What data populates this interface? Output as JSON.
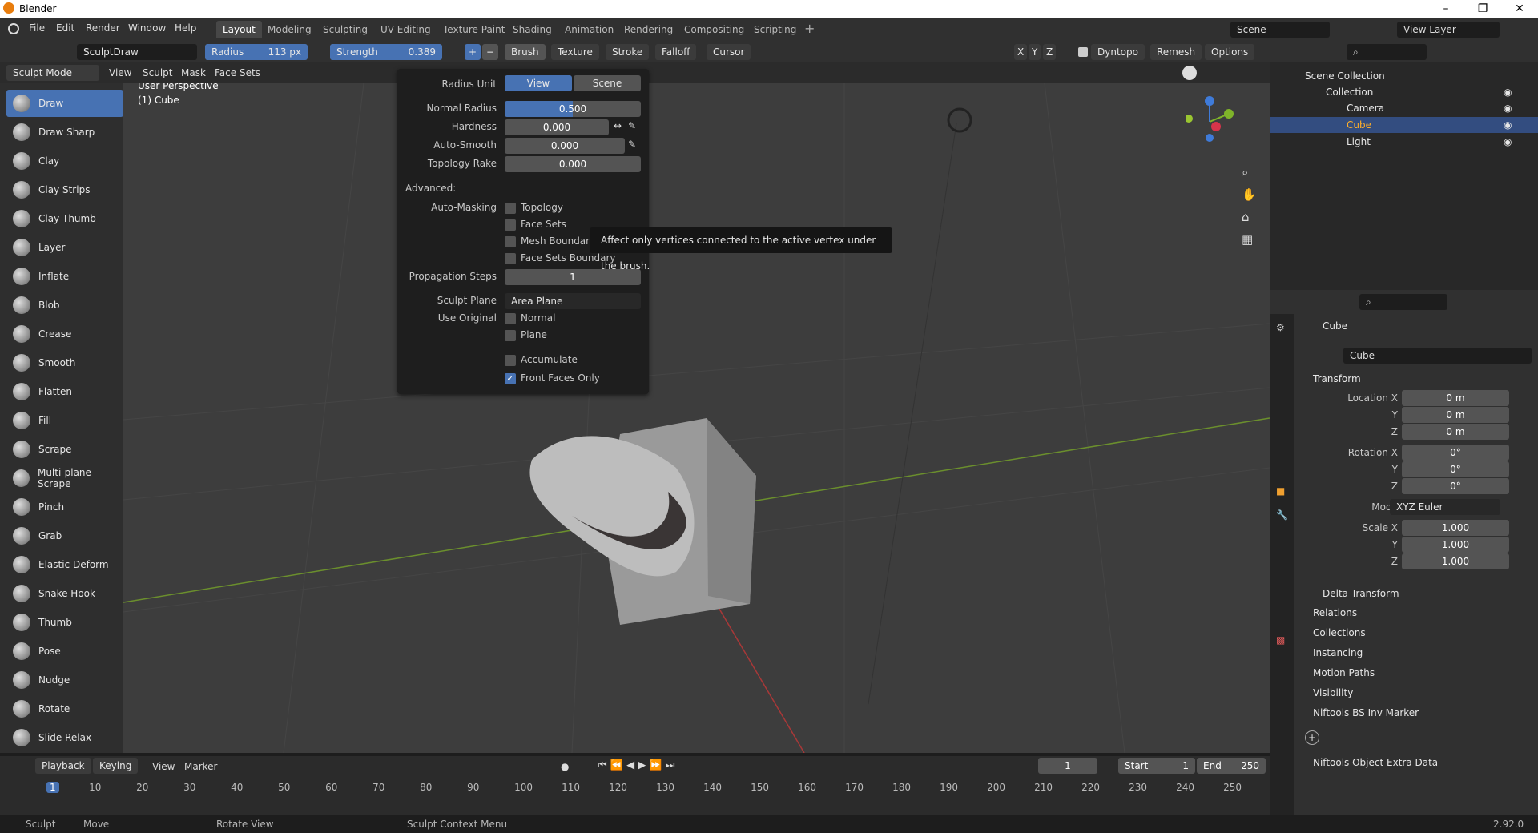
{
  "window": {
    "title": "Blender"
  },
  "menu": [
    "File",
    "Edit",
    "Render",
    "Window",
    "Help"
  ],
  "workspaces": [
    "Layout",
    "Modeling",
    "Sculpting",
    "UV Editing",
    "Texture Paint",
    "Shading",
    "Animation",
    "Rendering",
    "Compositing",
    "Scripting"
  ],
  "scene": "Scene",
  "view_layer": "View Layer",
  "header": {
    "brush_name": "SculptDraw",
    "radius_label": "Radius",
    "radius_value": "113 px",
    "strength_label": "Strength",
    "strength_value": "0.389",
    "menus": [
      "Brush",
      "Texture",
      "Stroke",
      "Falloff",
      "Cursor"
    ],
    "axes": [
      "X",
      "Y",
      "Z"
    ],
    "dyntopo": "Dyntopo",
    "remesh": "Remesh",
    "options": "Options"
  },
  "header2": {
    "mode": "Sculpt Mode",
    "menus": [
      "View",
      "Sculpt",
      "Mask",
      "Face Sets"
    ]
  },
  "viewport": {
    "perspective": "User Perspective",
    "object": "(1) Cube"
  },
  "tools": [
    "Draw",
    "Draw Sharp",
    "Clay",
    "Clay Strips",
    "Clay Thumb",
    "Layer",
    "Inflate",
    "Blob",
    "Crease",
    "Smooth",
    "Flatten",
    "Fill",
    "Scrape",
    "Multi-plane Scrape",
    "Pinch",
    "Grab",
    "Elastic Deform",
    "Snake Hook",
    "Thumb",
    "Pose",
    "Nudge",
    "Rotate",
    "Slide Relax"
  ],
  "popover": {
    "radius_unit_label": "Radius Unit",
    "view_btn": "View",
    "scene_btn": "Scene",
    "normal_radius_label": "Normal Radius",
    "normal_radius": "0.500",
    "normal_radius_fraction": 0.5,
    "hardness_label": "Hardness",
    "hardness": "0.000",
    "auto_smooth_label": "Auto-Smooth",
    "auto_smooth": "0.000",
    "topology_rake_label": "Topology Rake",
    "topology_rake": "0.000",
    "advanced_label": "Advanced:",
    "auto_masking_label": "Auto-Masking",
    "masking": [
      "Topology",
      "Face Sets",
      "Mesh Boundary",
      "Face Sets Boundary"
    ],
    "propagation_label": "Propagation Steps",
    "propagation": "1",
    "sculpt_plane_label": "Sculpt Plane",
    "sculpt_plane": "Area Plane",
    "use_original_label": "Use Original",
    "normal": "Normal",
    "plane": "Plane",
    "accumulate": "Accumulate",
    "front_faces_only": "Front Faces Only",
    "front_faces_checked": true
  },
  "tooltip": "Affect only vertices connected to the active vertex under the brush.",
  "outliner": {
    "scene_collection": "Scene Collection",
    "collection": "Collection",
    "items": [
      "Camera",
      "Cube",
      "Light"
    ]
  },
  "properties": {
    "object_name": "Cube",
    "object_field": "Cube",
    "transform": "Transform",
    "location_label": "Location X",
    "location": [
      "0 m",
      "0 m",
      "0 m"
    ],
    "rotation_label": "Rotation X",
    "rotation": [
      "0°",
      "0°",
      "0°"
    ],
    "mode_label": "Mode",
    "mode": "XYZ Euler",
    "scale_label": "Scale X",
    "scale": [
      "1.000",
      "1.000",
      "1.000"
    ],
    "y": "Y",
    "z": "Z",
    "delta": "Delta Transform",
    "sections": [
      "Relations",
      "Collections",
      "Instancing",
      "Motion Paths",
      "Visibility",
      "Niftools BS Inv Marker",
      "Niftools Object Extra Data"
    ]
  },
  "timeline": {
    "menus": [
      "Playback",
      "Keying",
      "View",
      "Marker"
    ],
    "current_frame": "1",
    "start_label": "Start",
    "start": "1",
    "end_label": "End",
    "end": "250",
    "ticks": [
      "1",
      "10",
      "20",
      "30",
      "40",
      "50",
      "60",
      "70",
      "80",
      "90",
      "100",
      "110",
      "120",
      "130",
      "140",
      "150",
      "160",
      "170",
      "180",
      "190",
      "200",
      "210",
      "220",
      "230",
      "240",
      "250"
    ]
  },
  "status": {
    "sculpt": "Sculpt",
    "move": "Move",
    "rotate_view": "Rotate View",
    "context_menu": "Sculpt Context Menu",
    "version": "2.92.0"
  }
}
